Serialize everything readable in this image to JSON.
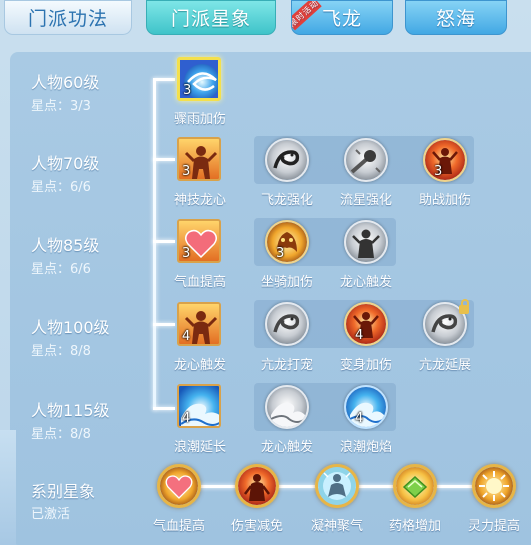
{
  "tabs": [
    {
      "label": "门派功法",
      "state": "inactive"
    },
    {
      "label": "门派星象",
      "state": "active"
    },
    {
      "label": "飞龙",
      "state": "blue",
      "badge": "限时活动"
    },
    {
      "label": "怒海",
      "state": "blue"
    }
  ],
  "rows": [
    {
      "title": "人物60级",
      "stars": "星点：3/3",
      "main": {
        "name": "骤雨加伤",
        "level": "3",
        "icon": "blue-vortex-icon"
      },
      "subs": []
    },
    {
      "title": "人物70级",
      "stars": "星点：6/6",
      "main": {
        "name": "神技龙心",
        "level": "3",
        "icon": "warrior-silhouette-icon"
      },
      "subs": [
        {
          "name": "飞龙强化",
          "level": "",
          "icon": "dragon-icon",
          "locked": false
        },
        {
          "name": "流星强化",
          "level": "",
          "icon": "meteor-icon",
          "locked": false
        },
        {
          "name": "助战加伤",
          "level": "3",
          "icon": "fire-figure-icon",
          "locked": false
        }
      ]
    },
    {
      "title": "人物85级",
      "stars": "星点：6/6",
      "main": {
        "name": "气血提高",
        "level": "3",
        "icon": "heart-icon"
      },
      "subs": [
        {
          "name": "坐骑加伤",
          "level": "3",
          "icon": "golden-beast-icon",
          "locked": false
        },
        {
          "name": "龙心触发",
          "level": "",
          "icon": "dark-figure-icon",
          "locked": false
        }
      ]
    },
    {
      "title": "人物100级",
      "stars": "星点：8/8",
      "main": {
        "name": "龙心触发",
        "level": "4",
        "icon": "warrior-silhouette-icon"
      },
      "subs": [
        {
          "name": "亢龙打宠",
          "level": "",
          "icon": "dragon-icon",
          "locked": false
        },
        {
          "name": "变身加伤",
          "level": "4",
          "icon": "fire-figure-icon",
          "locked": false
        },
        {
          "name": "亢龙延展",
          "level": "",
          "icon": "dragon-icon",
          "locked": true
        }
      ]
    },
    {
      "title": "人物115级",
      "stars": "星点：8/8",
      "main": {
        "name": "浪潮延长",
        "level": "4",
        "icon": "wave-icon"
      },
      "subs": [
        {
          "name": "龙心触发",
          "level": "",
          "icon": "gray-wave-icon",
          "locked": false
        },
        {
          "name": "浪潮炮焰",
          "level": "4",
          "icon": "wave-icon",
          "locked": false
        }
      ]
    }
  ],
  "series": {
    "title": "系别星象",
    "status": "已激活",
    "items": [
      {
        "name": "气血提高",
        "icon": "heart-icon"
      },
      {
        "name": "伤害减免",
        "icon": "armored-figure-icon"
      },
      {
        "name": "凝神聚气",
        "icon": "meditating-figure-icon"
      },
      {
        "name": "药格增加",
        "icon": "green-gem-icon"
      },
      {
        "name": "灵力提高",
        "icon": "radiant-hand-icon"
      }
    ]
  }
}
